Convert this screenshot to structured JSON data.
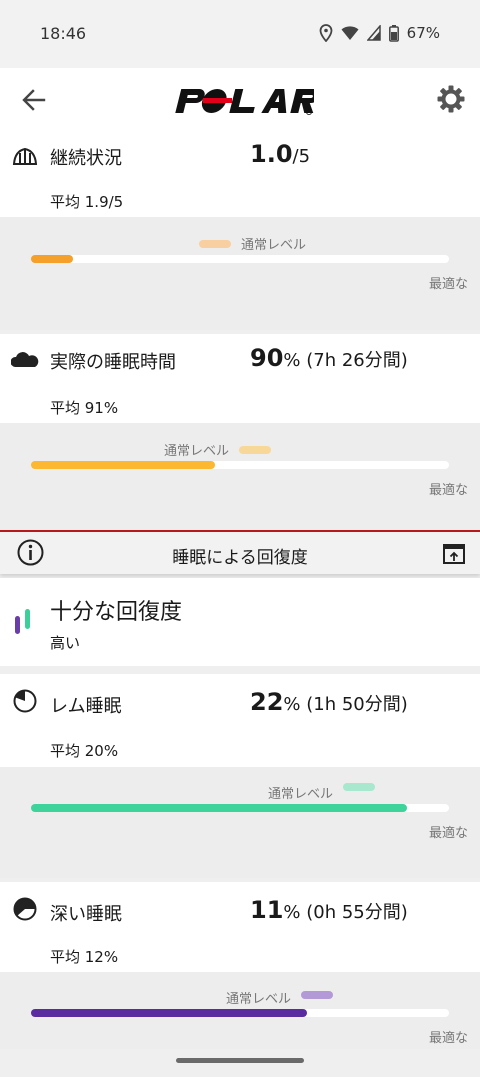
{
  "status_bar": {
    "time": "18:46",
    "battery": "67%",
    "icons": [
      "location-icon",
      "wifi-icon",
      "signal-icon",
      "battery-icon"
    ]
  },
  "app_bar": {
    "brand": "POLAR",
    "back_icon": "back-arrow-icon",
    "settings_icon": "gear-icon"
  },
  "continuity": {
    "title": "継続状況",
    "value_main": "1.0",
    "value_suffix": "/5",
    "average": "平均 1.9/5",
    "normal_label": "通常レベル",
    "optimal_label": "最適な",
    "progress_fraction": 0.1,
    "color": "#f5a02a",
    "normal_color": "#f8cfa0"
  },
  "actual_sleep": {
    "title": "実際の睡眠時間",
    "value_main": "90",
    "value_suffix": "%",
    "value_extra": "(7h 26分間)",
    "average": "平均 91%",
    "normal_label": "通常レベル",
    "optimal_label": "最適な",
    "progress_fraction": 0.44,
    "color": "#fbb830",
    "normal_color": "#f8d898"
  },
  "banner": {
    "label": "睡眠による回復度",
    "info_icon": "info-icon",
    "share_icon": "share-icon",
    "accent": "#b71c1c"
  },
  "recovery": {
    "title": "十分な回復度",
    "level": "高い",
    "colors": [
      "#6a3ea8",
      "#3ccf9a"
    ]
  },
  "rem_sleep": {
    "title": "レム睡眠",
    "value_main": "22",
    "value_suffix": "%",
    "value_extra": "(1h 50分間)",
    "average": "平均 20%",
    "normal_label": "通常レベル",
    "optimal_label": "最適な",
    "progress_fraction": 0.9,
    "color": "#3dd39a",
    "normal_color": "#a8e8cf"
  },
  "deep_sleep": {
    "title": "深い睡眠",
    "value_main": "11",
    "value_suffix": "%",
    "value_extra": "(0h 55分間)",
    "average": "平均 12%",
    "normal_label": "通常レベル",
    "optimal_label": "最適な",
    "progress_fraction": 0.66,
    "color": "#5a2c9f",
    "normal_color": "#b39ad6"
  }
}
